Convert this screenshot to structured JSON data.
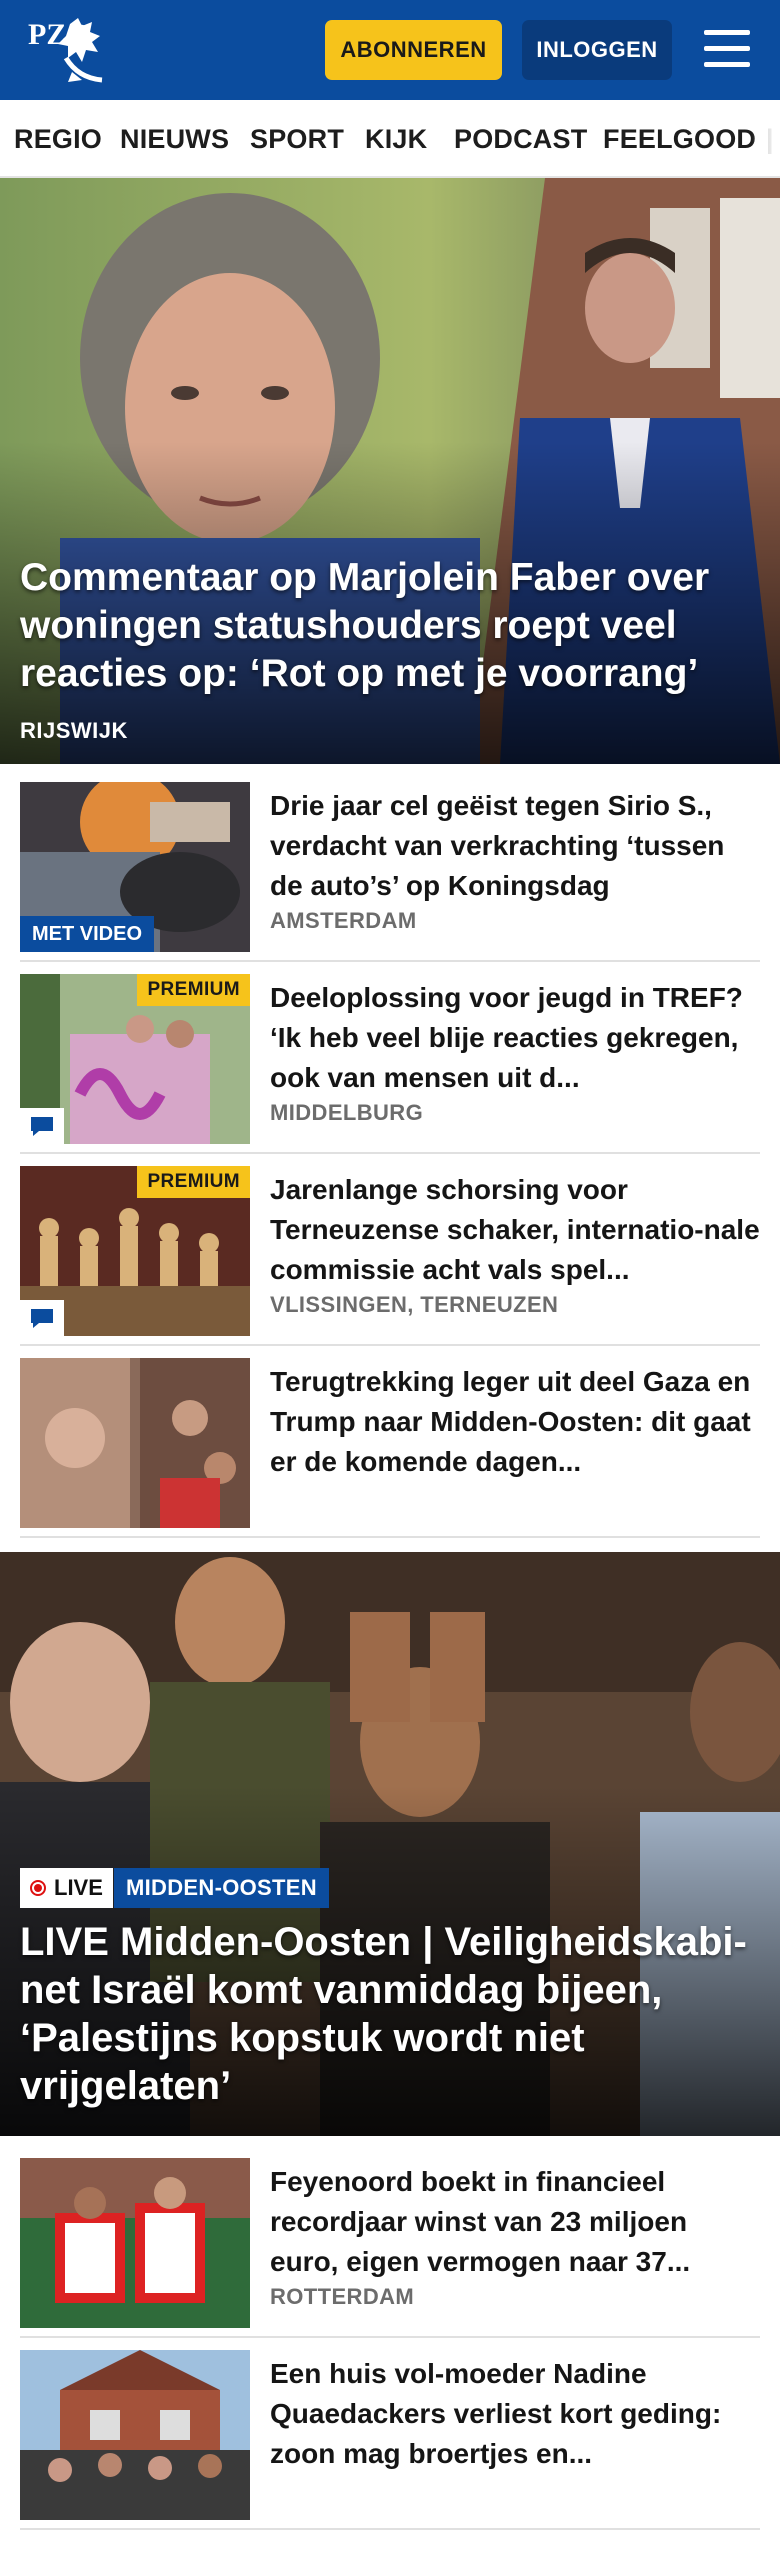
{
  "header": {
    "logo_letters": "PZC",
    "subscribe_label": "ABONNEREN",
    "login_label": "INLOGGEN",
    "menu_icon": "hamburger-icon",
    "brand_color": "#0b4c9e",
    "accent_color": "#f6c31b"
  },
  "nav": {
    "items": [
      "REGIO",
      "NIEUWS",
      "SPORT",
      "KIJK",
      "PODCAST",
      "FEELGOOD"
    ]
  },
  "hero": {
    "title": "Commentaar op Marjolein Faber over woningen statushouders roept veel reacties op: ‘Rot op met je voorrang’",
    "tag": "RIJSWIJK"
  },
  "articles": [
    {
      "title": "Drie jaar cel geëist tegen Sirio S., verdacht van verkrachting ‘tussen de auto’s’ op Koningsdag",
      "tag": "AMSTERDAM",
      "badge": "MET VIDEO"
    },
    {
      "title": "Deeloplossing voor jeugd in TREF? ‘Ik heb veel blije reacties gekregen, ook van mensen uit d...",
      "tag": "MIDDELBURG",
      "badge": "PREMIUM"
    },
    {
      "title": "Jarenlange schorsing voor Terneuzense schaker, internatio-nale commissie acht vals spel...",
      "tag": "VLISSINGEN, TERNEUZEN",
      "badge": "PREMIUM"
    },
    {
      "title": "Terugtrekking leger uit deel Gaza en Trump naar Midden-Oosten: dit gaat er de komende dagen...",
      "tag": "",
      "badge": ""
    }
  ],
  "feature": {
    "live_label": "LIVE",
    "category": "MIDDEN-OOSTEN",
    "title": "LIVE Midden-Oosten | Veiligheidskabi-net Israël komt vanmiddag bijeen, ‘Palestijns kopstuk wordt niet vrijgelaten’"
  },
  "articles2": [
    {
      "title": "Feyenoord boekt in financieel recordjaar winst van 23 miljoen euro, eigen vermogen naar 37...",
      "tag": "ROTTERDAM"
    },
    {
      "title": "Een huis vol-moeder Nadine Quaedackers verliest kort geding: zoon mag broertjes en...",
      "tag": ""
    }
  ]
}
